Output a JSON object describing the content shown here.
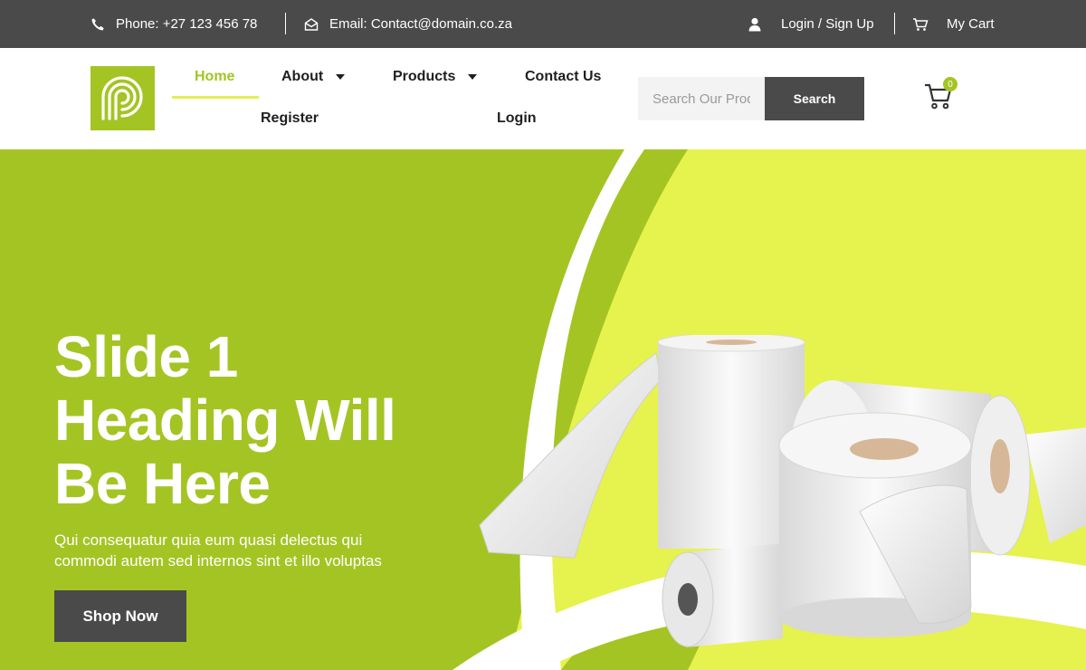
{
  "topbar": {
    "phone": "Phone: +27 123 456 78",
    "email": "Email: Contact@domain.co.za",
    "login": "Login / Sign Up",
    "cart": "My Cart"
  },
  "nav": {
    "home": "Home",
    "about": "About",
    "products": "Products",
    "contact": "Contact Us",
    "register": "Register",
    "login": "Login"
  },
  "search": {
    "placeholder": "Search Our Products",
    "button": "Search"
  },
  "cart": {
    "count": "0"
  },
  "hero": {
    "heading_lines": [
      "Slide 1",
      "Heading Will",
      "Be Here"
    ],
    "subtext_lines": [
      "Qui consequatur quia eum quasi delectus qui",
      "commodi autem sed internos sint et illo voluptas"
    ],
    "button": "Shop Now"
  },
  "colors": {
    "brand_green": "#a4c423",
    "lime": "#e6f24e",
    "dark_gray": "#4a4a4a"
  },
  "icons": [
    "phone-icon",
    "envelope-icon",
    "user-icon",
    "cart-icon",
    "caret-down-icon",
    "search",
    "logo-icon"
  ]
}
